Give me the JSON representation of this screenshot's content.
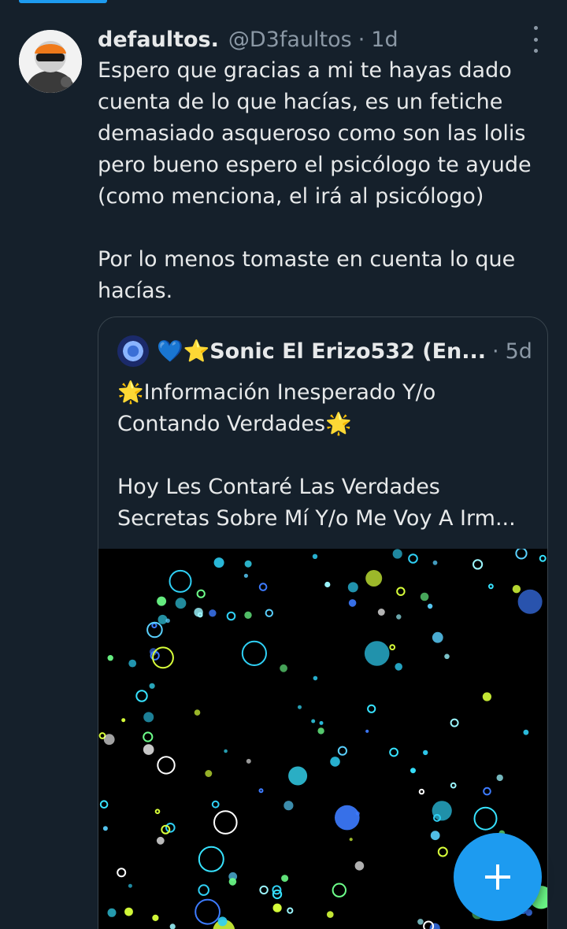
{
  "tweet": {
    "display_name": "defaultos.",
    "handle": "@D3faultos",
    "separator": "·",
    "time": "1d",
    "text": "Espero que gracias a mi te hayas dado\ncuenta de lo que hacías, es un fetiche\ndemasiado asqueroso como son las lolis\npero bueno espero el psicólogo te ayude\n(como menciona, el irá al psicólogo)\n\nPor lo menos tomaste en cuenta lo que\nhacías."
  },
  "quote": {
    "author": "💙⭐Sonic El Erizo532 (En...",
    "separator": "·",
    "time": "5d",
    "text": "🌟Información Inesperado Y/o\nContando Verdades🌟\n\nHoy Les Contaré Las Verdades\nSecretas Sobre Mí Y/o Me Voy A Irm..."
  },
  "icons": {
    "more": "more-vertical-icon",
    "compose": "plus-icon"
  },
  "colors": {
    "background": "#15202b",
    "accent": "#1d9bf0",
    "secondary_text": "#8b98a5",
    "border": "#38444d"
  }
}
